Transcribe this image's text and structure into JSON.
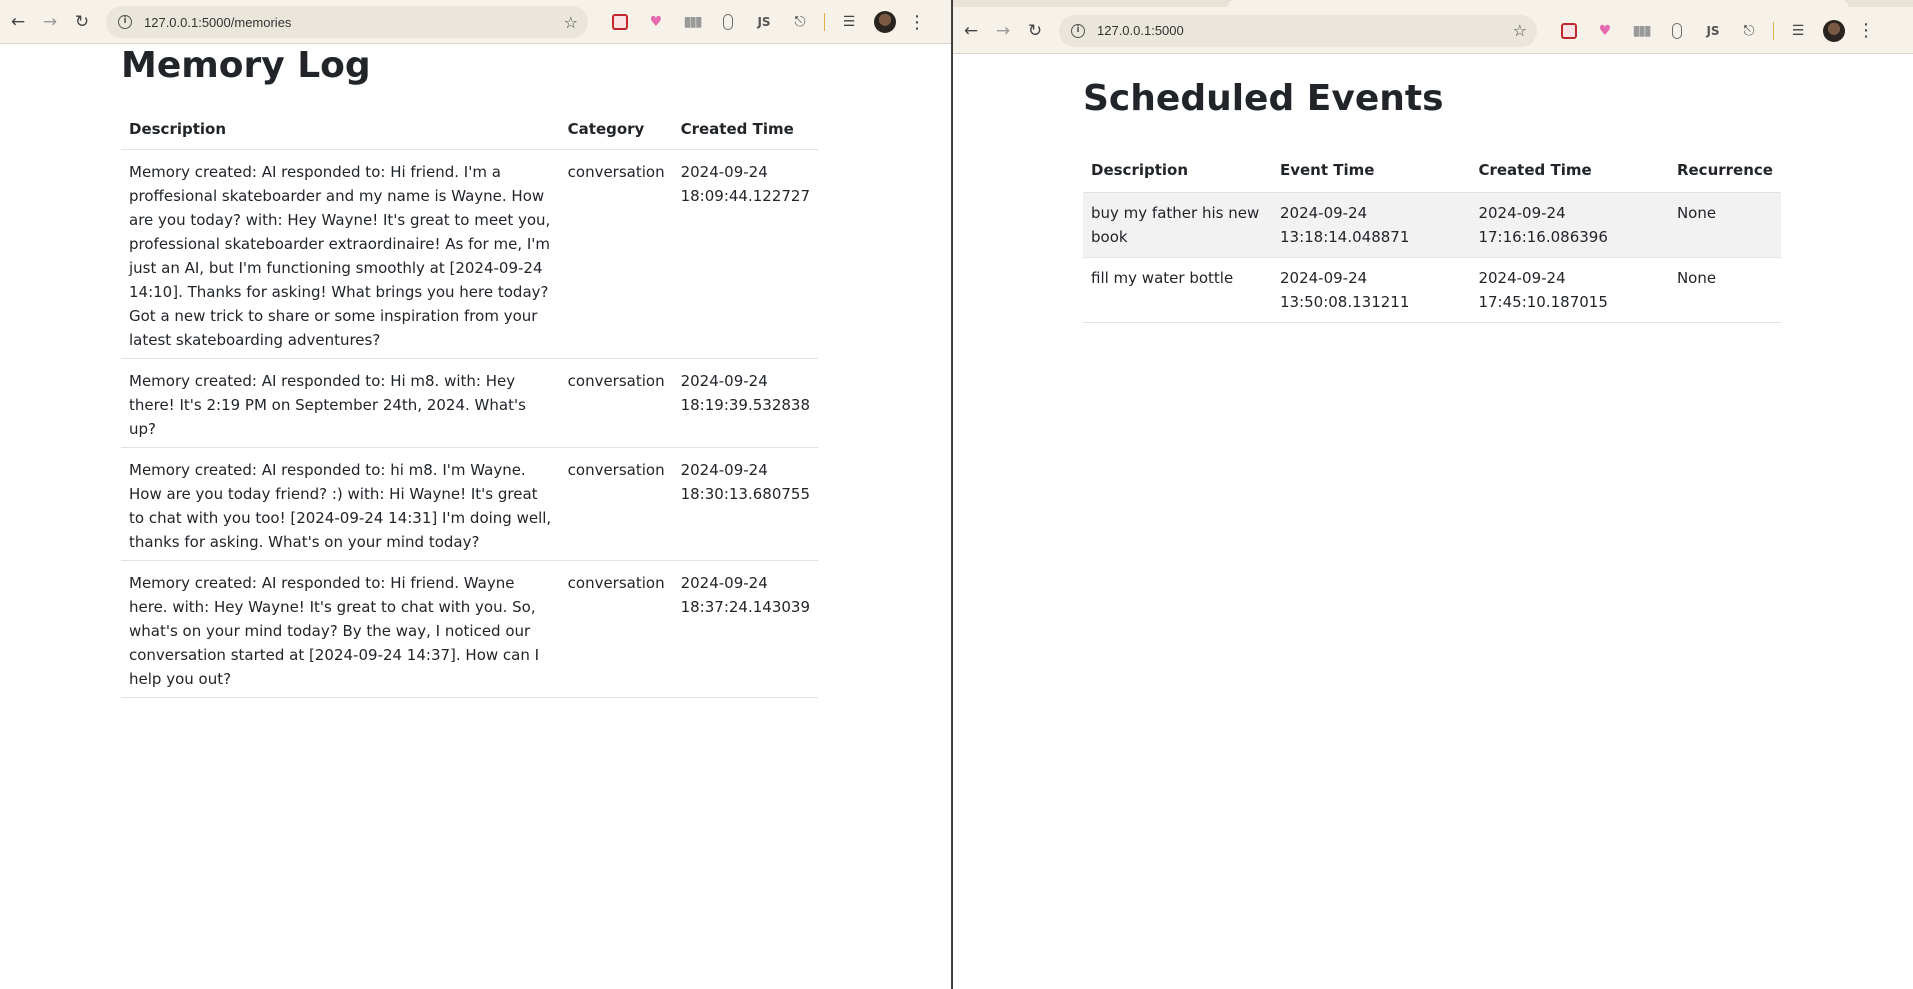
{
  "left_window": {
    "url": "127.0.0.1:5000/memories",
    "page_title": "Memory Log",
    "table": {
      "headers": [
        "Description",
        "Category",
        "Created Time"
      ],
      "rows": [
        {
          "description": "Memory created: AI responded to: Hi friend. I'm a proffesional skateboarder and my name is Wayne. How are you today? with: Hey Wayne! It's great to meet you, professional skateboarder extraordinaire! As for me, I'm just an AI, but I'm functioning smoothly at [2024-09-24 14:10]. Thanks for asking! What brings you here today? Got a new trick to share or some inspiration from your latest skateboarding adventures?",
          "category": "conversation",
          "created_date": "2024-09-24",
          "created_clock": "18:09:44.122727"
        },
        {
          "description": "Memory created: AI responded to: Hi m8. with: Hey there! It's 2:19 PM on September 24th, 2024. What's up?",
          "category": "conversation",
          "created_date": "2024-09-24",
          "created_clock": "18:19:39.532838"
        },
        {
          "description": "Memory created: AI responded to: hi m8. I'm Wayne. How are you today friend? :) with: Hi Wayne! It's great to chat with you too! [2024-09-24 14:31] I'm doing well, thanks for asking. What's on your mind today?",
          "category": "conversation",
          "created_date": "2024-09-24",
          "created_clock": "18:30:13.680755"
        },
        {
          "description": "Memory created: AI responded to: Hi friend. Wayne here. with: Hey Wayne! It's great to chat with you. So, what's on your mind today? By the way, I noticed our conversation started at [2024-09-24 14:37]. How can I help you out?",
          "category": "conversation",
          "created_date": "2024-09-24",
          "created_clock": "18:37:24.143039"
        }
      ]
    }
  },
  "right_window": {
    "url": "127.0.0.1:5000",
    "page_title": "Scheduled Events",
    "table": {
      "headers": [
        "Description",
        "Event Time",
        "Created Time",
        "Recurrence"
      ],
      "rows": [
        {
          "description": "buy my father his new book",
          "event_date": "2024-09-24",
          "event_clock": "13:18:14.048871",
          "created_date": "2024-09-24",
          "created_clock": "17:16:16.086396",
          "recurrence": "None"
        },
        {
          "description": "fill my water bottle",
          "event_date": "2024-09-24",
          "event_clock": "13:50:08.131211",
          "created_date": "2024-09-24",
          "created_clock": "17:45:10.187015",
          "recurrence": "None"
        }
      ]
    }
  },
  "toolbar": {
    "back_icon": "arrow-left-icon",
    "forward_icon": "arrow-right-icon",
    "reload_icon": "reload-icon",
    "site_info_icon": "info-circle-icon",
    "bookmark_icon": "star-icon",
    "extensions": [
      "red-play-extension-icon",
      "heart-extension-icon",
      "bars-extension-icon",
      "pill-extension-icon",
      "js-extension-icon",
      "puzzle-extensions-icon",
      "media-control-icon"
    ],
    "menu_icon": "kebab-menu-icon"
  }
}
